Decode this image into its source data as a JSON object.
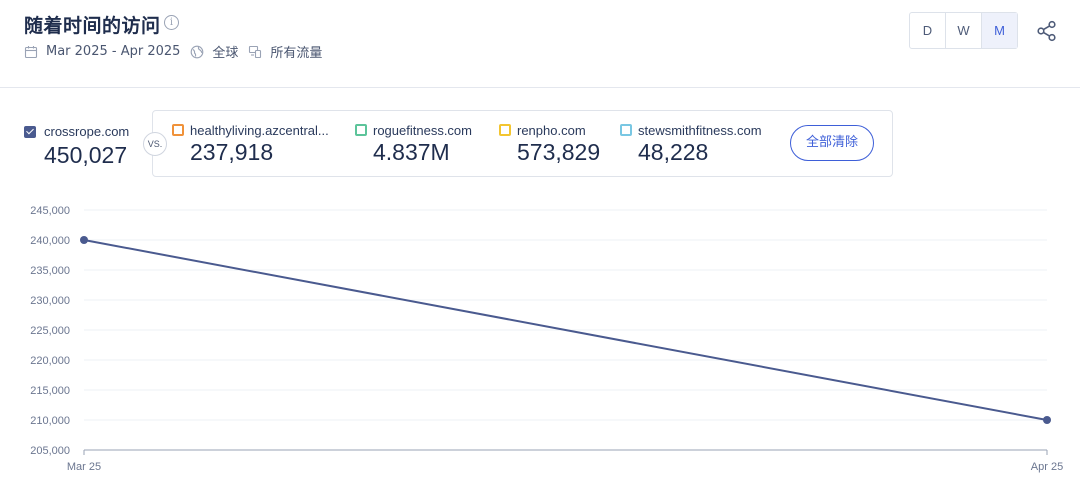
{
  "header": {
    "title": "随着时间的访问",
    "date_range": "Mar 2025 - Apr 2025",
    "region": "全球",
    "traffic": "所有流量",
    "granularity": [
      "D",
      "W",
      "M"
    ],
    "active_granularity": "M"
  },
  "primary": {
    "domain": "crossrope.com",
    "value": "450,027",
    "color": "#4a5a8f"
  },
  "vs_label": "VS.",
  "competitors": [
    {
      "domain": "healthyliving.azcentral...",
      "value": "237,918",
      "color": "#f0923a"
    },
    {
      "domain": "roguefitness.com",
      "value": "4.837M",
      "color": "#5cc49a"
    },
    {
      "domain": "renpho.com",
      "value": "573,829",
      "color": "#f3c530"
    },
    {
      "domain": "stewsmithfitness.com",
      "value": "48,228",
      "color": "#79c7e3"
    }
  ],
  "clear_all_label": "全部清除",
  "chart_data": {
    "type": "line",
    "x": [
      "Mar 25",
      "Apr 25"
    ],
    "series": [
      {
        "name": "crossrope.com",
        "values": [
          240000,
          210000
        ],
        "color": "#4a5a8f"
      }
    ],
    "ylim": [
      205000,
      245000
    ],
    "yticks": [
      "205,000",
      "210,000",
      "215,000",
      "220,000",
      "225,000",
      "230,000",
      "235,000",
      "240,000",
      "245,000"
    ],
    "yticks_values": [
      205000,
      210000,
      215000,
      220000,
      225000,
      230000,
      235000,
      240000,
      245000
    ],
    "grid": true
  }
}
